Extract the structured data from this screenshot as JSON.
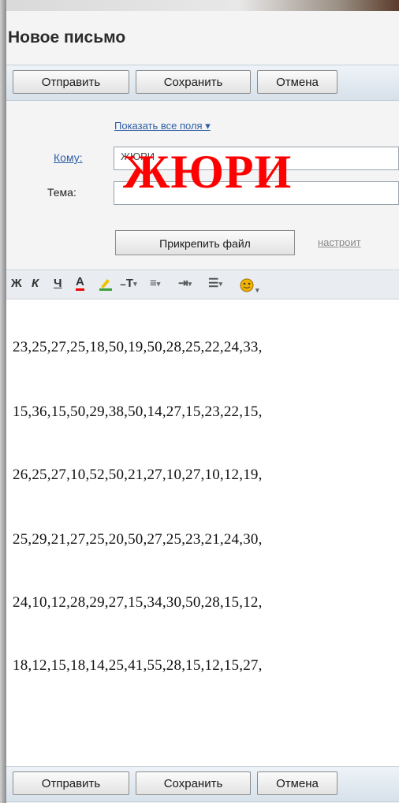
{
  "window": {
    "title": "Новое письмо"
  },
  "toolbar": {
    "send_label": "Отправить",
    "save_label": "Сохранить",
    "cancel_label": "Отмена"
  },
  "compose": {
    "show_all_fields": "Показать все поля ▾",
    "to_label": "Кому:",
    "to_value": "ЖЮРИ",
    "subject_label": "Тема:",
    "subject_value": "",
    "attach_label": "Прикрепить файл",
    "setup_link": "настроит"
  },
  "overlay": {
    "jury_text": "ЖЮРИ",
    "color": "#ff0000"
  },
  "format_toolbar": {
    "icons": [
      "bold-icon",
      "italic-icon",
      "underline-icon",
      "text-color-icon",
      "highlight-icon",
      "font-size-icon",
      "align-icon",
      "indent-icon",
      "list-icon",
      "emoji-icon"
    ]
  },
  "message_lines": [
    "23,25,27,25,18,50,19,50,28,25,22,24,33,",
    "15,36,15,50,29,38,50,14,27,15,23,22,15,",
    "26,25,27,10,52,50,21,27,10,27,10,12,19,",
    "25,29,21,27,25,20,50,27,25,23,21,24,30,",
    "24,10,12,28,29,27,15,34,30,50,28,15,12,",
    "18,12,15,18,14,25,41,55,28,15,12,15,27,"
  ],
  "colors": {
    "link": "#2f5fa6",
    "toolbar_bg": "#dde6ee",
    "accent_red": "#ff0000"
  }
}
